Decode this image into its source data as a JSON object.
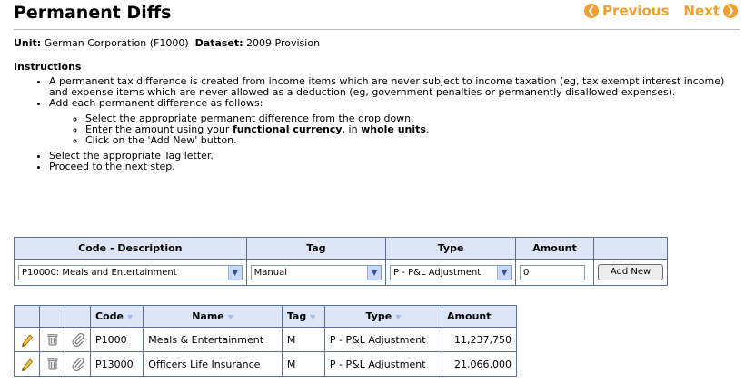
{
  "header": {
    "title": "Permanent Diffs",
    "prev_label": "Previous",
    "next_label": "Next"
  },
  "context": {
    "unit_label": "Unit:",
    "unit_value": "German Corporation (F1000)",
    "dataset_label": "Dataset:",
    "dataset_value": "2009 Provision"
  },
  "instructions": {
    "heading": "Instructions",
    "bullet1": "A permanent tax difference is created from income items which are never subject to income taxation (eg, tax exempt interest income) and expense items which are never allowed as a deduction (eg, government penalties or permanently disallowed expenses).",
    "bullet2": "Add each permanent difference as follows:",
    "sub1": "Select the appropriate permanent difference from the drop down.",
    "sub2_pre": "Enter the amount using your ",
    "sub2_bold1": "functional currency",
    "sub2_mid": ", in ",
    "sub2_bold2": "whole units",
    "sub2_post": ".",
    "sub3": "Click on the 'Add New' button.",
    "bullet3": "Select the appropriate Tag letter.",
    "bullet4": "Proceed to the next step."
  },
  "entry_form": {
    "headers": {
      "code": "Code - Description",
      "tag": "Tag",
      "type": "Type",
      "amount": "Amount"
    },
    "code_value": "P10000: Meals and Entertainment",
    "tag_value": "Manual",
    "type_value": "P - P&L Adjustment",
    "amount_value": "0",
    "add_button": "Add New"
  },
  "list": {
    "headers": {
      "code": "Code",
      "name": "Name",
      "tag": "Tag",
      "type": "Type",
      "amount": "Amount"
    },
    "rows": [
      {
        "code": "P1000",
        "name": "Meals & Entertainment",
        "tag": "M",
        "type": "P - P&L Adjustment",
        "amount": "11,237,750"
      },
      {
        "code": "P13000",
        "name": "Officers Life Insurance",
        "tag": "M",
        "type": "P - P&L Adjustment",
        "amount": "21,066,000"
      }
    ]
  },
  "icons": {
    "edit": "pencil-icon",
    "delete": "trash-icon",
    "attach": "paperclip-icon",
    "prev": "previous-arrow-icon",
    "next": "next-arrow-icon",
    "sort": "sort-icon",
    "dropdown": "chevron-down-icon"
  },
  "colors": {
    "nav_accent": "#f0a030",
    "header_bg": "#dde6f6",
    "border": "#5a7098"
  }
}
